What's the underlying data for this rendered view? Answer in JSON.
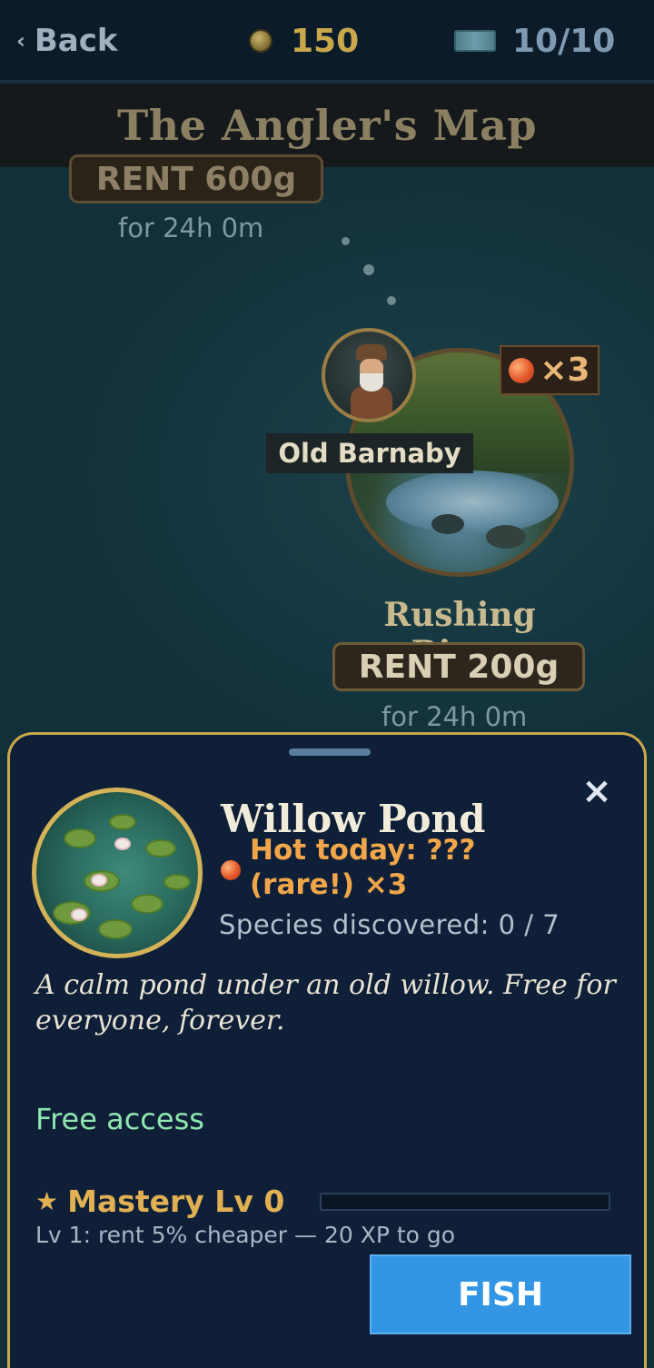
{
  "header": {
    "back_label": "Back",
    "back_chevron": "‹",
    "coins": "150",
    "tickets": "10/10"
  },
  "title": "The Angler's Map",
  "map": {
    "locations": [
      {
        "rent_label": "RENT 600g",
        "duration": "for 24h 0m"
      },
      {
        "name": "Rushing River",
        "rent_label": "RENT 200g",
        "duration": "for 24h 0m",
        "hot_multiplier": "×3",
        "npc_name": "Old Barnaby"
      }
    ]
  },
  "sheet": {
    "close_symbol": "×",
    "location_name": "Willow Pond",
    "hot_today": "Hot today: ??? (rare!) ×3",
    "species_discovered": "Species discovered: 0 / 7",
    "description": "A calm pond under an old willow. Free for everyone, forever.",
    "access": "Free access",
    "mastery_label": "Mastery Lv 0",
    "mastery_star": "★",
    "mastery_progress": 0,
    "next_level": "Lv 1: rent 5% cheaper — 20 XP to go",
    "fish_button": "FISH"
  },
  "colors": {
    "gold": "#c9a84c",
    "hot_orange": "#f2a64a",
    "free_green": "#8fe7b0",
    "fish_blue": "#3396e4"
  },
  "icons": [
    "chevron-left-icon",
    "coin-icon",
    "ticket-icon",
    "close-icon",
    "star-icon",
    "hot-fish-icon"
  ]
}
